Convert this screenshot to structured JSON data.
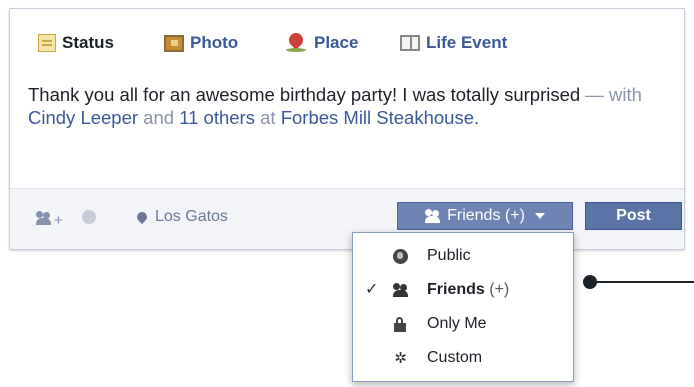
{
  "tabs": [
    {
      "label": "Status",
      "icon": "status-icon",
      "active": true
    },
    {
      "label": "Photo",
      "icon": "photo-icon",
      "active": false
    },
    {
      "label": "Place",
      "icon": "place-icon",
      "active": false
    },
    {
      "label": "Life Event",
      "icon": "life-event-icon",
      "active": false
    }
  ],
  "post": {
    "text": "Thank you all for an awesome birthday party! I was totally surprised",
    "with_prefix": " — with ",
    "tagged_person": "Cindy Leeper",
    "and_text": " and ",
    "others": "11 others",
    "at_text": " at ",
    "place": "Forbes Mill Steakhouse."
  },
  "toolbar": {
    "location": "Los Gatos",
    "audience_label": "Friends (+)",
    "post_label": "Post"
  },
  "menu": {
    "items": [
      {
        "label": "Public",
        "icon": "globe-icon",
        "selected": false
      },
      {
        "label": "Friends",
        "suffix": "(+)",
        "icon": "friends-icon",
        "selected": true
      },
      {
        "label": "Only Me",
        "icon": "lock-icon",
        "selected": false
      },
      {
        "label": "Custom",
        "icon": "gear-icon",
        "selected": false
      }
    ],
    "check_glyph": "✓"
  },
  "colors": {
    "link": "#3b5998",
    "button": "#6d84b4",
    "post_button": "#5b74a8",
    "muted": "#8a94a8"
  }
}
